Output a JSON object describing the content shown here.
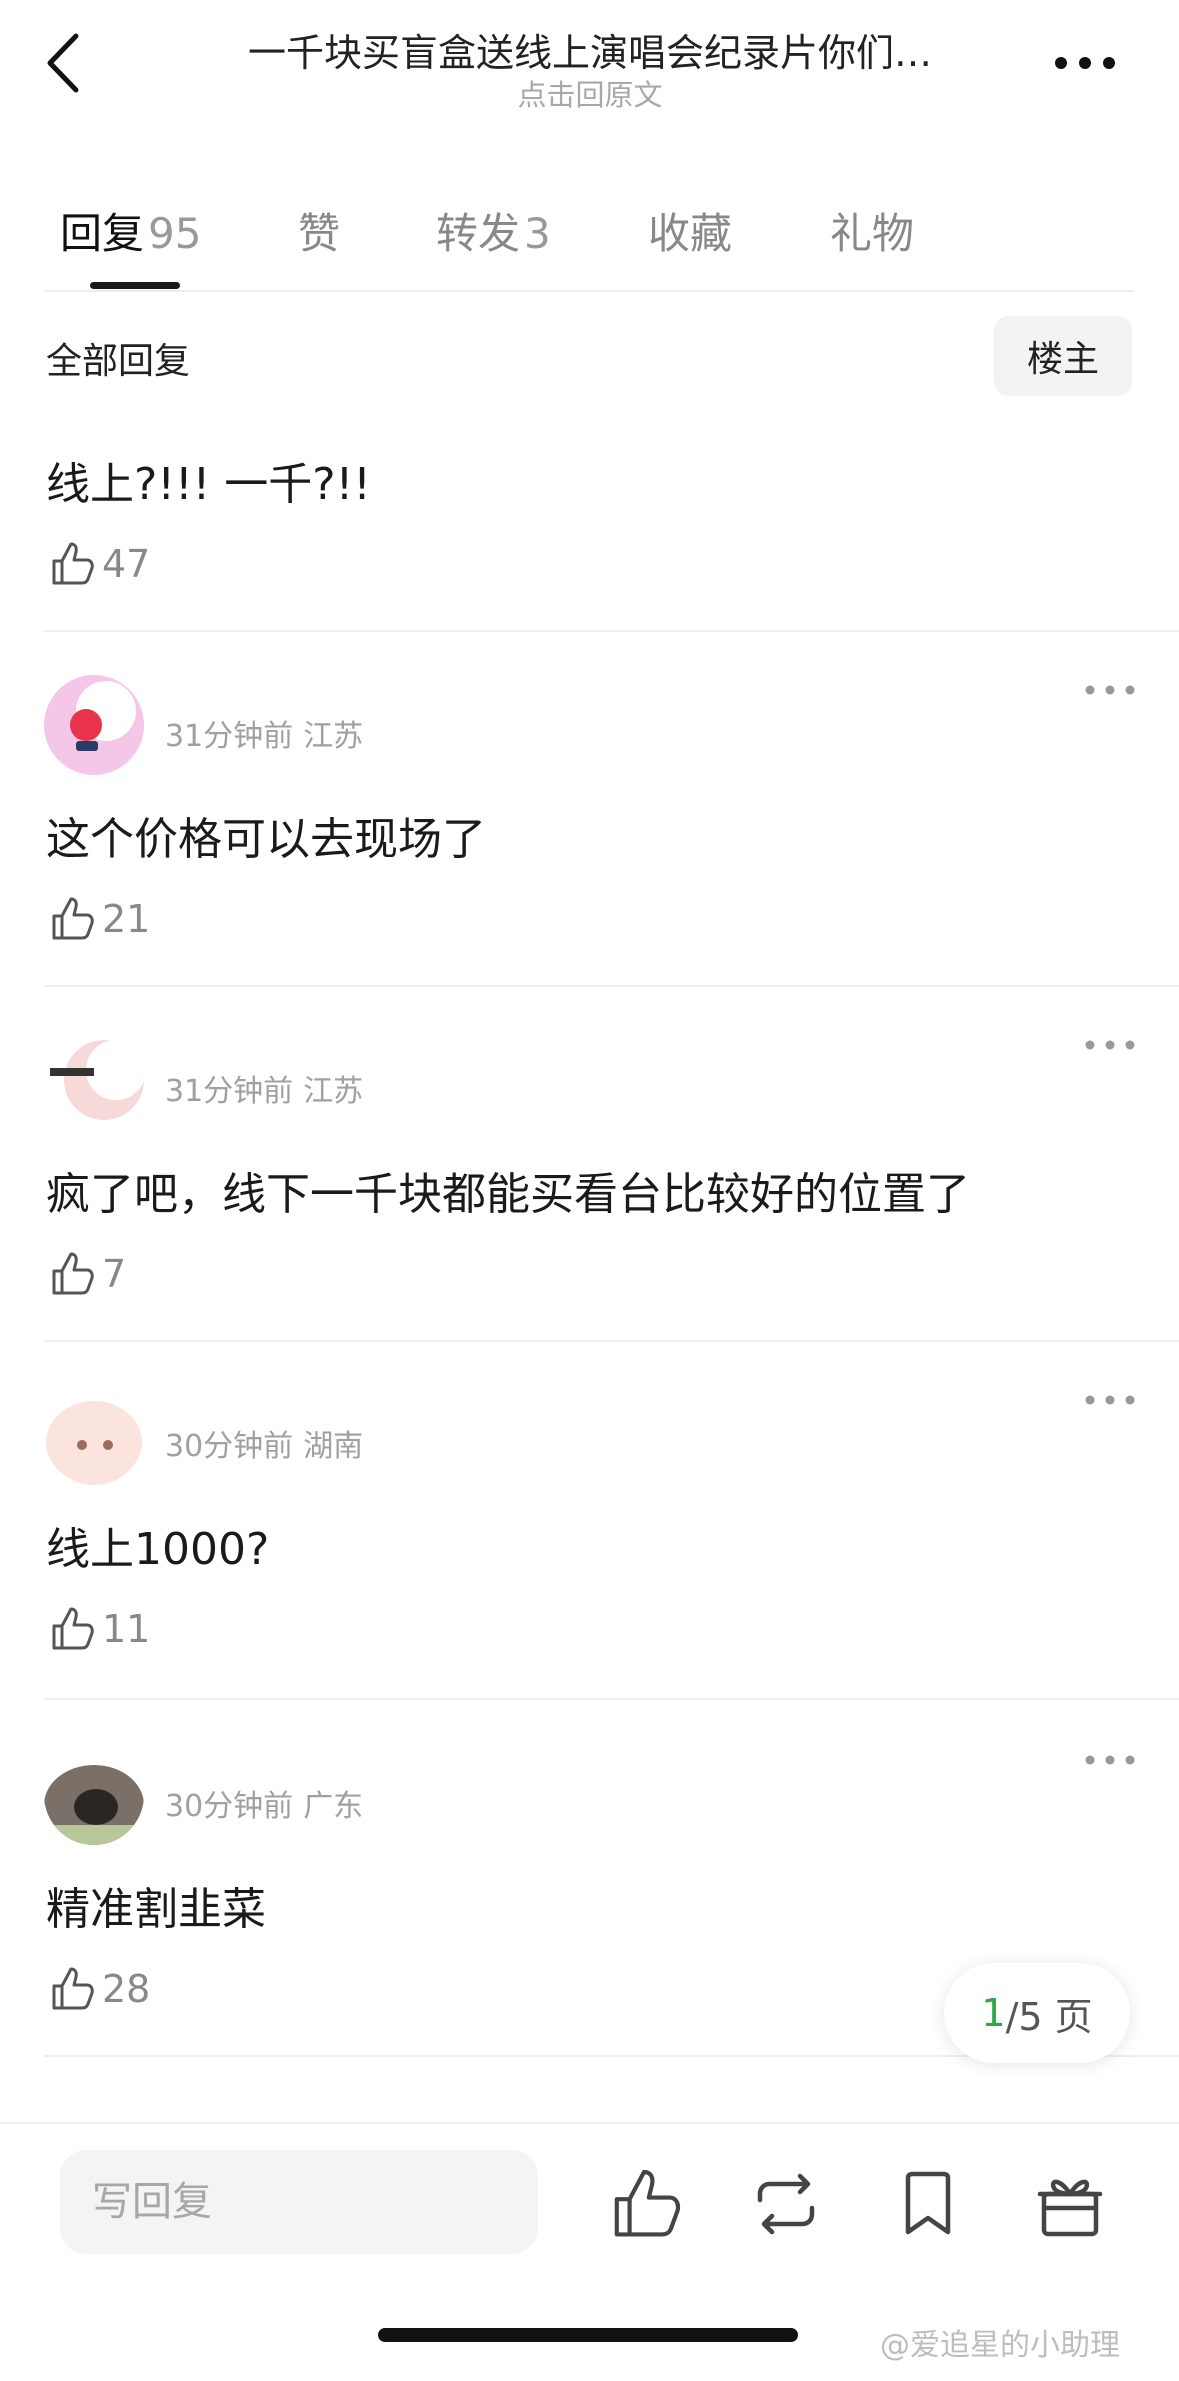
{
  "header": {
    "title": "一千块买盲盒送线上演唱会纪录片你们…",
    "subtitle": "点击回原文"
  },
  "tabs": [
    {
      "label": "回复",
      "count": "95",
      "active": true
    },
    {
      "label": "赞",
      "count": ""
    },
    {
      "label": "转发",
      "count": "3"
    },
    {
      "label": "收藏",
      "count": ""
    },
    {
      "label": "礼物",
      "count": ""
    }
  ],
  "filter": {
    "title": "全部回复",
    "op_button": "楼主"
  },
  "op_reply": {
    "text": "线上?!!!  一千?!!",
    "likes": "47"
  },
  "replies": [
    {
      "time": "31分钟前",
      "location": "江苏",
      "text": "这个价格可以去现场了",
      "likes": "21",
      "avatar_color": "#f4c7e8"
    },
    {
      "time": "31分钟前",
      "location": "江苏",
      "text": "疯了吧，线下一千块都能买看台比较好的位置了",
      "likes": "7",
      "avatar_color": "#f6dada"
    },
    {
      "time": "30分钟前",
      "location": "湖南",
      "text": "线上1000?",
      "likes": "11",
      "avatar_color": "#fbe3de"
    },
    {
      "time": "30分钟前",
      "location": "广东",
      "text": "精准割韭菜",
      "likes": "28",
      "avatar_color": "#7a7068"
    }
  ],
  "pagination": {
    "current": "1",
    "total_text": "/5 页"
  },
  "bottom_bar": {
    "placeholder": "写回复"
  },
  "watermark": "@爱追星的小助理",
  "colors": {
    "accent_green": "#2aa84a",
    "divider": "#eeeeee",
    "muted_text": "#a0a0a0"
  }
}
